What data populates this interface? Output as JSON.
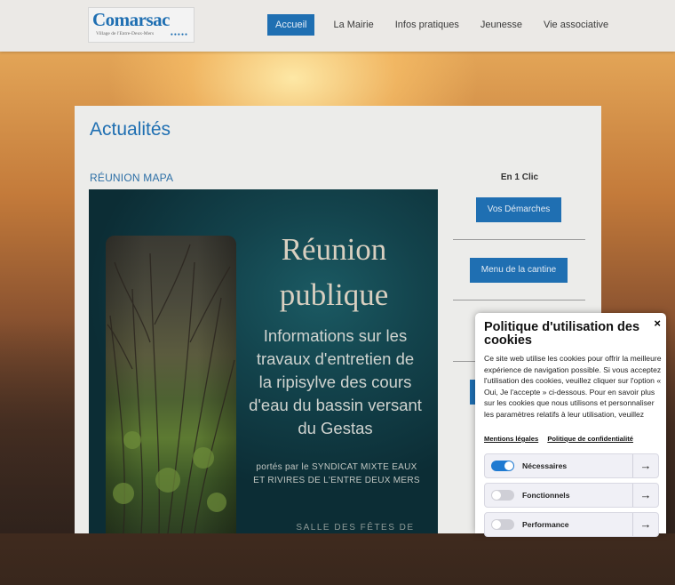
{
  "header": {
    "logo_main": "Comarsac",
    "logo_sub": "Village de l'Entre-Deux-Mers",
    "logo_dots": "●●●●●",
    "nav": [
      {
        "label": "Accueil",
        "active": true
      },
      {
        "label": "La Mairie"
      },
      {
        "label": "Infos pratiques"
      },
      {
        "label": "Jeunesse"
      },
      {
        "label": "Vie associative"
      }
    ]
  },
  "main": {
    "page_title": "Actualités",
    "article_title": "RÉUNION MAPA",
    "poster": {
      "heading_1": "Réunion",
      "heading_2": "publique",
      "body": "Informations sur les travaux d'entretien de la ripisylve des cours d'eau du bassin versant du Gestas",
      "small": "portés par le SYNDICAT MIXTE EAUX ET RIVIRES DE L'ENTRE DEUX MERS",
      "foot": "SALLE DES FÊTES DE"
    }
  },
  "sidebar": {
    "title": "En 1 Clic",
    "buttons": [
      {
        "label": "Vos Démarches"
      },
      {
        "label": "Menu de la cantine"
      }
    ]
  },
  "cookie": {
    "close": "×",
    "title": "Politique d'utilisation des cookies",
    "text": "Ce site web utilise les cookies pour offrir la meilleure expérience de navigation possible. Si vous acceptez l'utilisation des cookies, veuillez cliquer sur l'option « Oui, Je l'accepte » ci-dessous. Pour en savoir plus sur les cookies que nous utilisons et personnaliser les paramètres relatifs à leur utilisation, veuillez",
    "link_legal": "Mentions légales",
    "link_privacy": "Politique de confidentialité",
    "prefs": [
      {
        "label": "Nécessaires",
        "enabled": true
      },
      {
        "label": "Fonctionnels",
        "enabled": false
      },
      {
        "label": "Performance",
        "enabled": false
      }
    ],
    "arrow": "→"
  },
  "colors": {
    "accent": "#1f6fb2",
    "poster_bg": "#13434c",
    "toggle_on": "#1f7ad1"
  }
}
